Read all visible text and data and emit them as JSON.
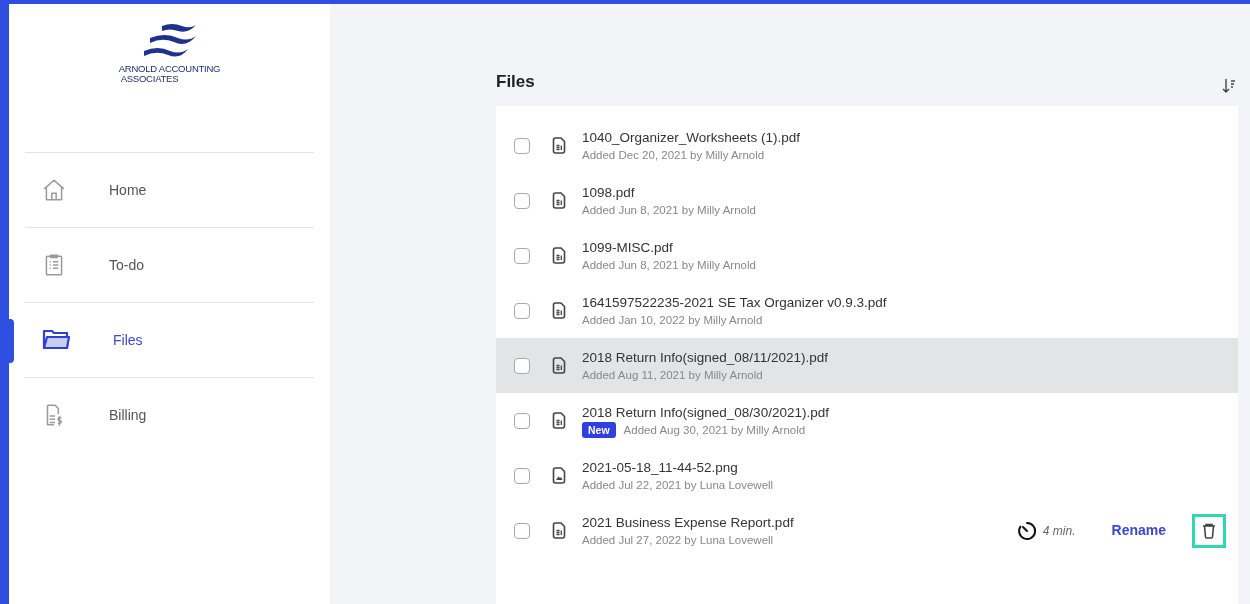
{
  "logo": {
    "line1": "ARNOLD ACCOUNTING",
    "line2": "ASSOCIATES"
  },
  "sidebar": {
    "items": [
      {
        "label": "Home",
        "kind": "home",
        "selected": false
      },
      {
        "label": "To-do",
        "kind": "todo",
        "selected": false
      },
      {
        "label": "Files",
        "kind": "folder",
        "selected": true
      },
      {
        "label": "Billing",
        "kind": "billing",
        "selected": false
      }
    ]
  },
  "files": {
    "title": "Files",
    "rows": [
      {
        "name": "1040_Organizer_Worksheets (1).pdf",
        "meta": "Added Dec 20, 2021 by Milly Arnold",
        "kind": "document",
        "checked": false,
        "highlighted": false
      },
      {
        "name": "1098.pdf",
        "meta": "Added Jun 8, 2021 by Milly Arnold",
        "kind": "document",
        "checked": false,
        "highlighted": false
      },
      {
        "name": "1099-MISC.pdf",
        "meta": "Added Jun 8, 2021 by Milly Arnold",
        "kind": "document",
        "checked": false,
        "highlighted": false
      },
      {
        "name": "1641597522235-2021 SE Tax Organizer v0.9.3.pdf",
        "meta": "Added Jan 10, 2022 by Milly Arnold",
        "kind": "document",
        "checked": false,
        "highlighted": false
      },
      {
        "name": "2018 Return Info(signed_08/11/2021).pdf",
        "meta": "Added Aug 11, 2021 by Milly Arnold",
        "kind": "document",
        "checked": false,
        "highlighted": true
      },
      {
        "name": "2018 Return Info(signed_08/30/2021).pdf",
        "meta": "Added Aug 30, 2021 by Milly Arnold",
        "badge": "New",
        "kind": "document",
        "checked": false,
        "highlighted": false
      },
      {
        "name": "2021-05-18_11-44-52.png",
        "meta": "Added Jul 22, 2021 by Luna Lovewell",
        "kind": "image",
        "checked": false,
        "highlighted": false
      },
      {
        "name": "2021 Business Expense Report.pdf",
        "meta": "Added Jul 27, 2022 by Luna Lovewell",
        "kind": "document",
        "checked": false,
        "highlighted": false,
        "timer": "4 min.",
        "rename": "Rename",
        "delete_focused": true
      }
    ]
  }
}
